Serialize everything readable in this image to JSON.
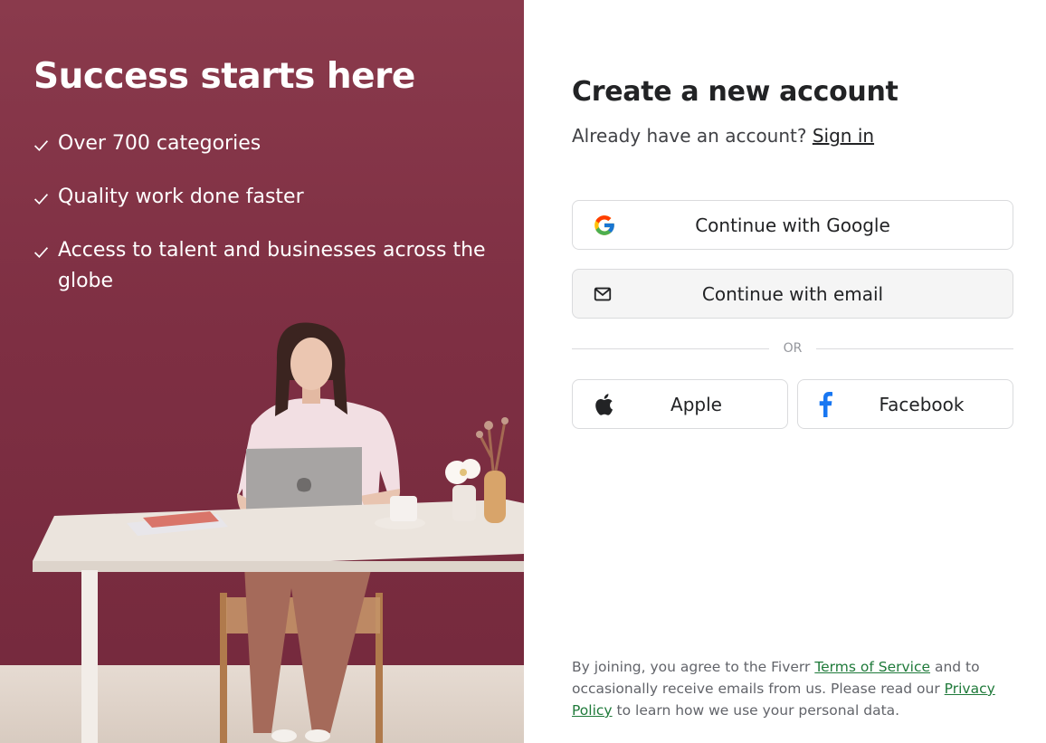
{
  "hero": {
    "title": "Success starts here",
    "benefits": [
      "Over 700 categories",
      "Quality work done faster",
      "Access to talent and businesses across the globe"
    ]
  },
  "form": {
    "title": "Create a new account",
    "signin_prompt": "Already have an account?",
    "signin_link": "Sign in",
    "google_label": "Continue with Google",
    "email_label": "Continue with email",
    "divider_label": "OR",
    "apple_label": "Apple",
    "facebook_label": "Facebook"
  },
  "legal": {
    "part1": "By joining, you agree to the Fiverr ",
    "terms_link": "Terms of Service",
    "part2": " and to occasionally receive emails from us. Please read our ",
    "privacy_link": "Privacy Policy",
    "part3": " to learn how we use your personal data."
  },
  "icons": {
    "check": "check-icon",
    "google": "google-icon",
    "email": "mail-icon",
    "apple": "apple-icon",
    "facebook": "facebook-icon"
  },
  "colors": {
    "hero_background": "#7e2f43",
    "link_green": "#1f7a3a",
    "google_blue": "#4285F4",
    "google_red": "#EA4335",
    "google_yellow": "#FBBC05",
    "google_green": "#34A853",
    "facebook_blue": "#1877F2"
  }
}
